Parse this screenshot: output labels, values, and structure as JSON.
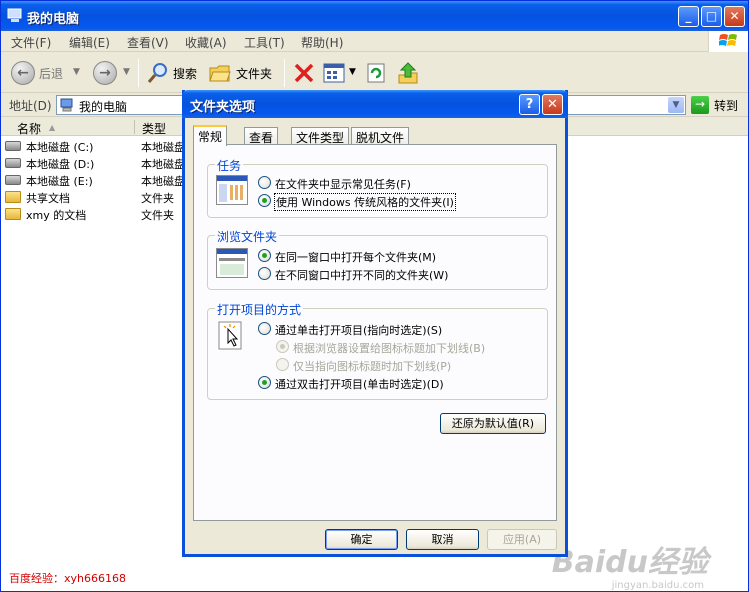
{
  "window": {
    "title": "我的电脑"
  },
  "menu": [
    "文件(F)",
    "编辑(E)",
    "查看(V)",
    "收藏(A)",
    "工具(T)",
    "帮助(H)"
  ],
  "toolbar": {
    "back": "后退",
    "search": "搜索",
    "folders": "文件夹"
  },
  "address": {
    "label": "地址(D)",
    "value": "我的电脑",
    "go": "转到"
  },
  "columns": {
    "name": "名称",
    "type": "类型"
  },
  "items": [
    {
      "name": "本地磁盘 (C:)",
      "type": "本地磁盘",
      "icon": "drive-icon"
    },
    {
      "name": "本地磁盘 (D:)",
      "type": "本地磁盘",
      "icon": "drive-icon"
    },
    {
      "name": "本地磁盘 (E:)",
      "type": "本地磁盘",
      "icon": "drive-icon"
    },
    {
      "name": "共享文档",
      "type": "文件夹",
      "icon": "folder-icon"
    },
    {
      "name": "xmy 的文档",
      "type": "文件夹",
      "icon": "folder-icon"
    }
  ],
  "dialog": {
    "title": "文件夹选项",
    "tabs": [
      "常规",
      "查看",
      "文件类型",
      "脱机文件"
    ],
    "groups": {
      "tasks": {
        "title": "任务",
        "options": [
          "在文件夹中显示常见任务(F)",
          "使用 Windows 传统风格的文件夹(I)"
        ],
        "selected": 1
      },
      "browse": {
        "title": "浏览文件夹",
        "options": [
          "在同一窗口中打开每个文件夹(M)",
          "在不同窗口中打开不同的文件夹(W)"
        ],
        "selected": 0
      },
      "click": {
        "title": "打开项目的方式",
        "options": [
          "通过单击打开项目(指向时选定)(S)",
          "根据浏览器设置给图标标题加下划线(B)",
          "仅当指向图标标题时加下划线(P)",
          "通过双击打开项目(单击时选定)(D)"
        ],
        "selected": 3
      }
    },
    "restore": "还原为默认值(R)",
    "ok": "确定",
    "cancel": "取消",
    "apply": "应用(A)"
  },
  "watermark": "百度经验：xyh666168",
  "brand": {
    "main": "Baidu经验",
    "sub": "jingyan.baidu.com"
  }
}
